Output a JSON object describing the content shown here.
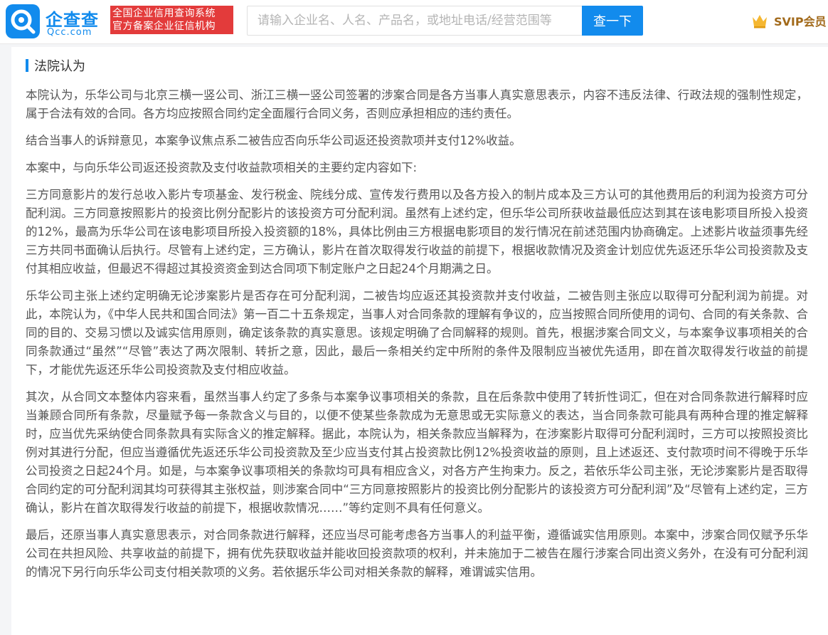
{
  "header": {
    "brand_name": "企查查",
    "brand_url": "Qcc.com",
    "slogan_line1": "全国企业信用查询系统",
    "slogan_line2": "官方备案企业征信机构",
    "search_placeholder": "请输入企业名、人名、产品名，或地址电话/经营范围等",
    "search_button": "查一下",
    "svip_label": "SVIP会员",
    "colors": {
      "brand": "#128bed",
      "slogan_bg": "#e33b3b",
      "svip": "#a26a1b"
    },
    "icons": {
      "logo": "qcc-logo-icon",
      "svip": "crown-icon"
    }
  },
  "section": {
    "title": "法院认为",
    "paragraphs": [
      "本院认为，乐华公司与北京三横一竖公司、浙江三横一竖公司签署的涉案合同是各方当事人真实意思表示，内容不违反法律、行政法规的强制性规定，属于合法有效的合同。各方均应按照合同约定全面履行合同义务，否则应承担相应的违约责任。",
      "结合当事人的诉辩意见，本案争议焦点系二被告应否向乐华公司返还投资款项并支付12%收益。",
      "本案中，与向乐华公司返还投资款及支付收益款项相关的主要约定内容如下:",
      "三方同意影片的发行总收入影片专项基金、发行税金、院线分成、宣传发行费用以及各方投入的制片成本及三方认可的其他费用后的利润为投资方可分配利润。三方同意按照影片的投资比例分配影片的该投资方可分配利润。虽然有上述约定，但乐华公司所获收益最低应达到其在该电影项目所投入投资的12%，最高为乐华公司在该电影项目所投入投资额的18%，具体比例由三方根据电影项目的发行情况在前述范围内协商确定。上述影片收益须事先经三方共同书面确认后执行。尽管有上述约定，三方确认，影片在首次取得发行收益的前提下，根据收款情况及资金计划应优先返还乐华公司投资款及支付其相应收益，但最迟不得超过其投资资金到达合同项下制定账户之日起24个月期满之日。",
      "乐华公司主张上述约定明确无论涉案影片是否存在可分配利润，二被告均应返还其投资款并支付收益，二被告则主张应以取得可分配利润为前提。对此，本院认为，《中华人民共和国合同法》第一百二十五条规定，当事人对合同条款的理解有争议的，应当按照合同所使用的词句、合同的有关条款、合同的目的、交易习惯以及诚实信用原则，确定该条款的真实意思。该规定明确了合同解释的规则。首先，根据涉案合同文义，与本案争议事项相关的合同条款通过“虽然”“尽管”表达了两次限制、转折之意，因此，最后一条相关约定中所附的条件及限制应当被优先适用，即在首次取得发行收益的前提下，才能优先返还乐华公司投资款及支付相应收益。",
      "其次，从合同文本整体内容来看，虽然当事人约定了多条与本案争议事项相关的条款，且在后条款中使用了转折性词汇，但在对合同条款进行解释时应当兼顾合同所有条款，尽量赋予每一条款含义与目的，以便不使某些条款成为无意思或无实际意义的表达，当合同条款可能具有两种合理的推定解释时，应当优先采纳使合同条款具有实际含义的推定解释。据此，本院认为，相关条款应当解释为，在涉案影片取得可分配利润时，三方可以按照投资比例对其进行分配，但应当遵循优先返还乐华公司投资款及至少应当支付其占投资款比例12%投资收益的原则，且上述返还、支付款项时间不得晚于乐华公司投资之日起24个月。如是，与本案争议事项相关的条款均可具有相应含义，对各方产生拘束力。反之，若依乐华公司主张，无论涉案影片是否取得合同约定的可分配利润其均可获得其主张权益，则涉案合同中“三方同意按照影片的投资比例分配影片的该投资方可分配利润”及“尽管有上述约定，三方确认，影片在首次取得发行收益的前提下，根据收款情况……”等约定则不具有任何意义。",
      "最后，还原当事人真实意思表示，对合同条款进行解释，还应当尽可能考虑各方当事人的利益平衡，遵循诚实信用原则。本案中，涉案合同仅赋予乐华公司在共担风险、共享收益的前提下，拥有优先获取收益并能收回投资款项的权利，并未施加于二被告在履行涉案合同出资义务外，在没有可分配利润的情况下另行向乐华公司支付相关款项的义务。若依据乐华公司对相关条款的解释，难谓诚实信用。"
    ]
  }
}
